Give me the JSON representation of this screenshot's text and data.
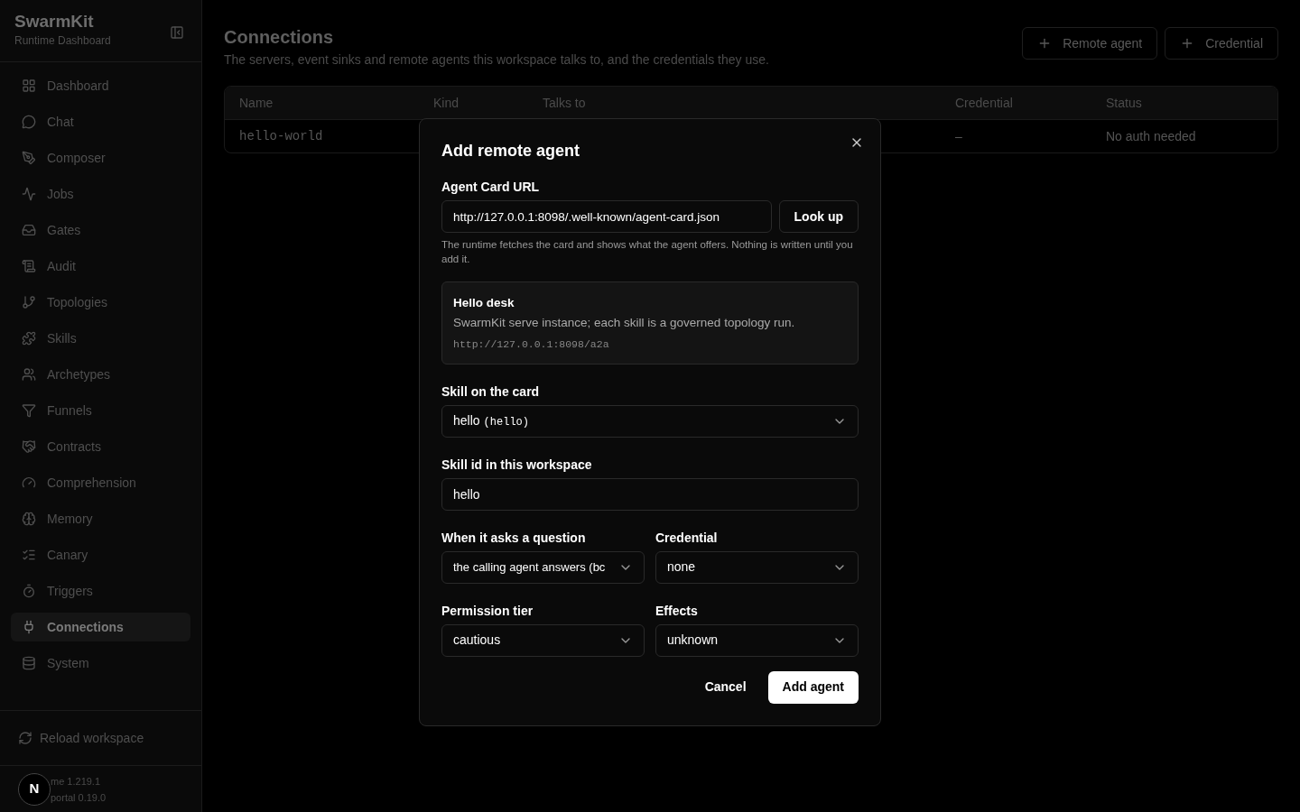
{
  "brand": {
    "title": "SwarmKit",
    "subtitle": "Runtime Dashboard"
  },
  "sidebar": {
    "items": [
      {
        "label": "Dashboard",
        "selected": false
      },
      {
        "label": "Chat",
        "selected": false
      },
      {
        "label": "Composer",
        "selected": false
      },
      {
        "label": "Jobs",
        "selected": false
      },
      {
        "label": "Gates",
        "selected": false
      },
      {
        "label": "Audit",
        "selected": false
      },
      {
        "label": "Topologies",
        "selected": false
      },
      {
        "label": "Skills",
        "selected": false
      },
      {
        "label": "Archetypes",
        "selected": false
      },
      {
        "label": "Funnels",
        "selected": false
      },
      {
        "label": "Contracts",
        "selected": false
      },
      {
        "label": "Comprehension",
        "selected": false
      },
      {
        "label": "Memory",
        "selected": false
      },
      {
        "label": "Canary",
        "selected": false
      },
      {
        "label": "Triggers",
        "selected": false
      },
      {
        "label": "Connections",
        "selected": true
      },
      {
        "label": "System",
        "selected": false
      }
    ],
    "reload": "Reload workspace",
    "versions": [
      "me 1.219.1",
      "portal 0.19.0"
    ],
    "badge": "N"
  },
  "page": {
    "title": "Connections",
    "subtitle": "The servers, event sinks and remote agents this workspace talks to, and the credentials they use.",
    "actions": [
      "Remote agent",
      "Credential"
    ]
  },
  "table": {
    "columns": [
      "Name",
      "Kind",
      "Talks to",
      "Credential",
      "Status"
    ],
    "rows": [
      [
        "hello-world",
        "",
        "",
        "–",
        "No auth needed"
      ]
    ]
  },
  "dialog": {
    "title": "Add remote agent",
    "url_label": "Agent Card URL",
    "url_value": "http://127.0.0.1:8098/.well-known/agent-card.json",
    "lookup": "Look up",
    "hint": "The runtime fetches the card and shows what the agent offers. Nothing is written until you add it.",
    "card": {
      "name": "Hello desk",
      "description": "SwarmKit serve instance; each skill is a governed topology run.",
      "endpoint": "http://127.0.0.1:8098/a2a"
    },
    "skill_label": "Skill on the card",
    "skill_value": "hello",
    "skill_code": "(hello)",
    "skill_id_label": "Skill id in this workspace",
    "skill_id_value": "hello",
    "selects": [
      {
        "label": "When it asks a question",
        "value": "the calling agent answers (bc"
      },
      {
        "label": "Credential",
        "value": "none"
      },
      {
        "label": "Permission tier",
        "value": "cautious"
      },
      {
        "label": "Effects",
        "value": "unknown"
      }
    ],
    "cancel": "Cancel",
    "submit": "Add agent"
  }
}
